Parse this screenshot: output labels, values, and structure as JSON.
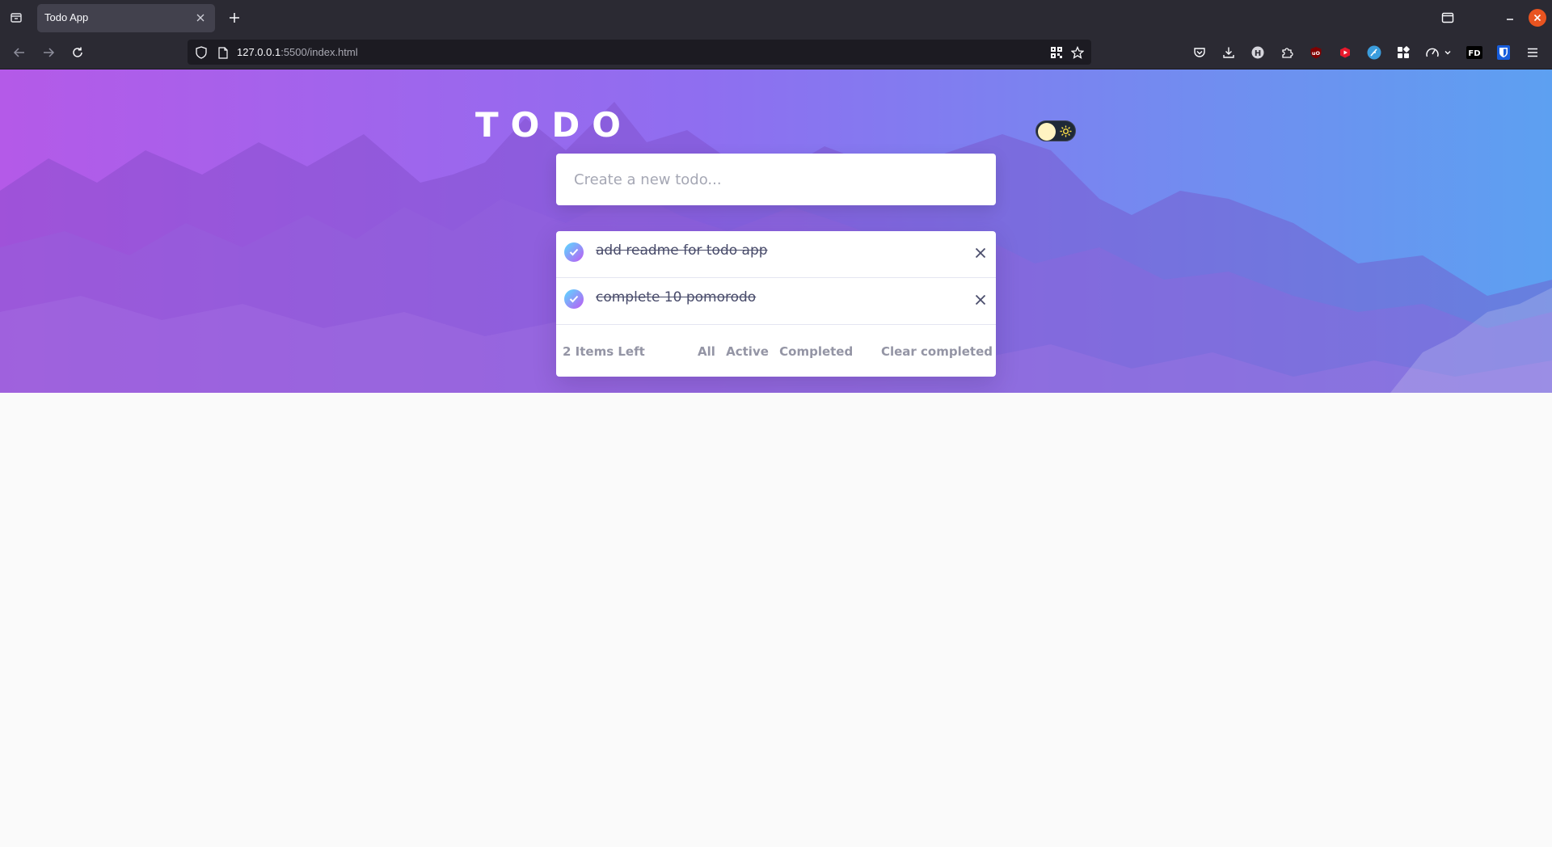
{
  "browser": {
    "tab_title": "Todo App",
    "url_host": "127.0.0.1",
    "url_rest": ":5500/index.html",
    "extensions": [
      "pocket-icon",
      "download-icon",
      "h-extension-icon",
      "extensions-icon",
      "ublock-icon",
      "youtube-icon",
      "feather-icon",
      "grid-extension-icon",
      "speed-icon",
      "fd-extension-icon",
      "bitwarden-icon",
      "menu-icon"
    ],
    "extension_fd_label": "FD",
    "extension_h_label": "H"
  },
  "app": {
    "title": "TODO",
    "new_todo_placeholder": "Create a new todo...",
    "todos": [
      {
        "text": "add readme for todo app",
        "completed": true
      },
      {
        "text": "complete 10 pomorodo",
        "completed": true
      }
    ],
    "items_left": "2 Items Left",
    "filters": {
      "all": "All",
      "active": "Active",
      "completed": "Completed"
    },
    "clear_completed": "Clear completed"
  },
  "colors": {
    "gradient_start": "#57ddff",
    "gradient_end": "#c058f3",
    "hero_left": "#b45ae8",
    "hero_right": "#5da0f1",
    "accent_orange": "#e95420"
  }
}
